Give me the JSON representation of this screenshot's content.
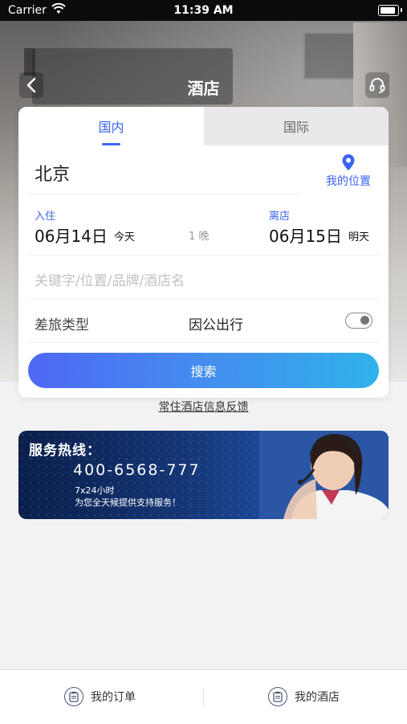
{
  "status_bar": {
    "carrier": "Carrier",
    "time": "11:39 AM"
  },
  "nav": {
    "title": "酒店",
    "back_icon": "chevron-left-icon",
    "service_icon": "headset-icon"
  },
  "tabs": [
    {
      "label": "国内",
      "active": true
    },
    {
      "label": "国际",
      "active": false
    }
  ],
  "search_form": {
    "city": "北京",
    "my_location": "我的位置",
    "checkin": {
      "label": "入住",
      "date": "06月14日",
      "day": "今天"
    },
    "nights": "1 晚",
    "checkout": {
      "label": "离店",
      "date": "06月15日",
      "day": "明天"
    },
    "keyword_placeholder": "关键字/位置/品牌/酒店名",
    "trip_type_label": "差旅类型",
    "trip_type_value": "因公出行",
    "search_button": "搜索"
  },
  "feedback_link": "常住酒店信息反馈",
  "banner": {
    "title": "服务热线：",
    "phone": "400-6568-777",
    "hours": "7x24小时",
    "description": "为您全天候提供支持服务！"
  },
  "bottom_bar": {
    "orders": "我的订单",
    "hotels": "我的酒店"
  },
  "colors": {
    "accent": "#3b63f6",
    "button_start": "#4e68f3",
    "button_end": "#2fb2ea"
  }
}
